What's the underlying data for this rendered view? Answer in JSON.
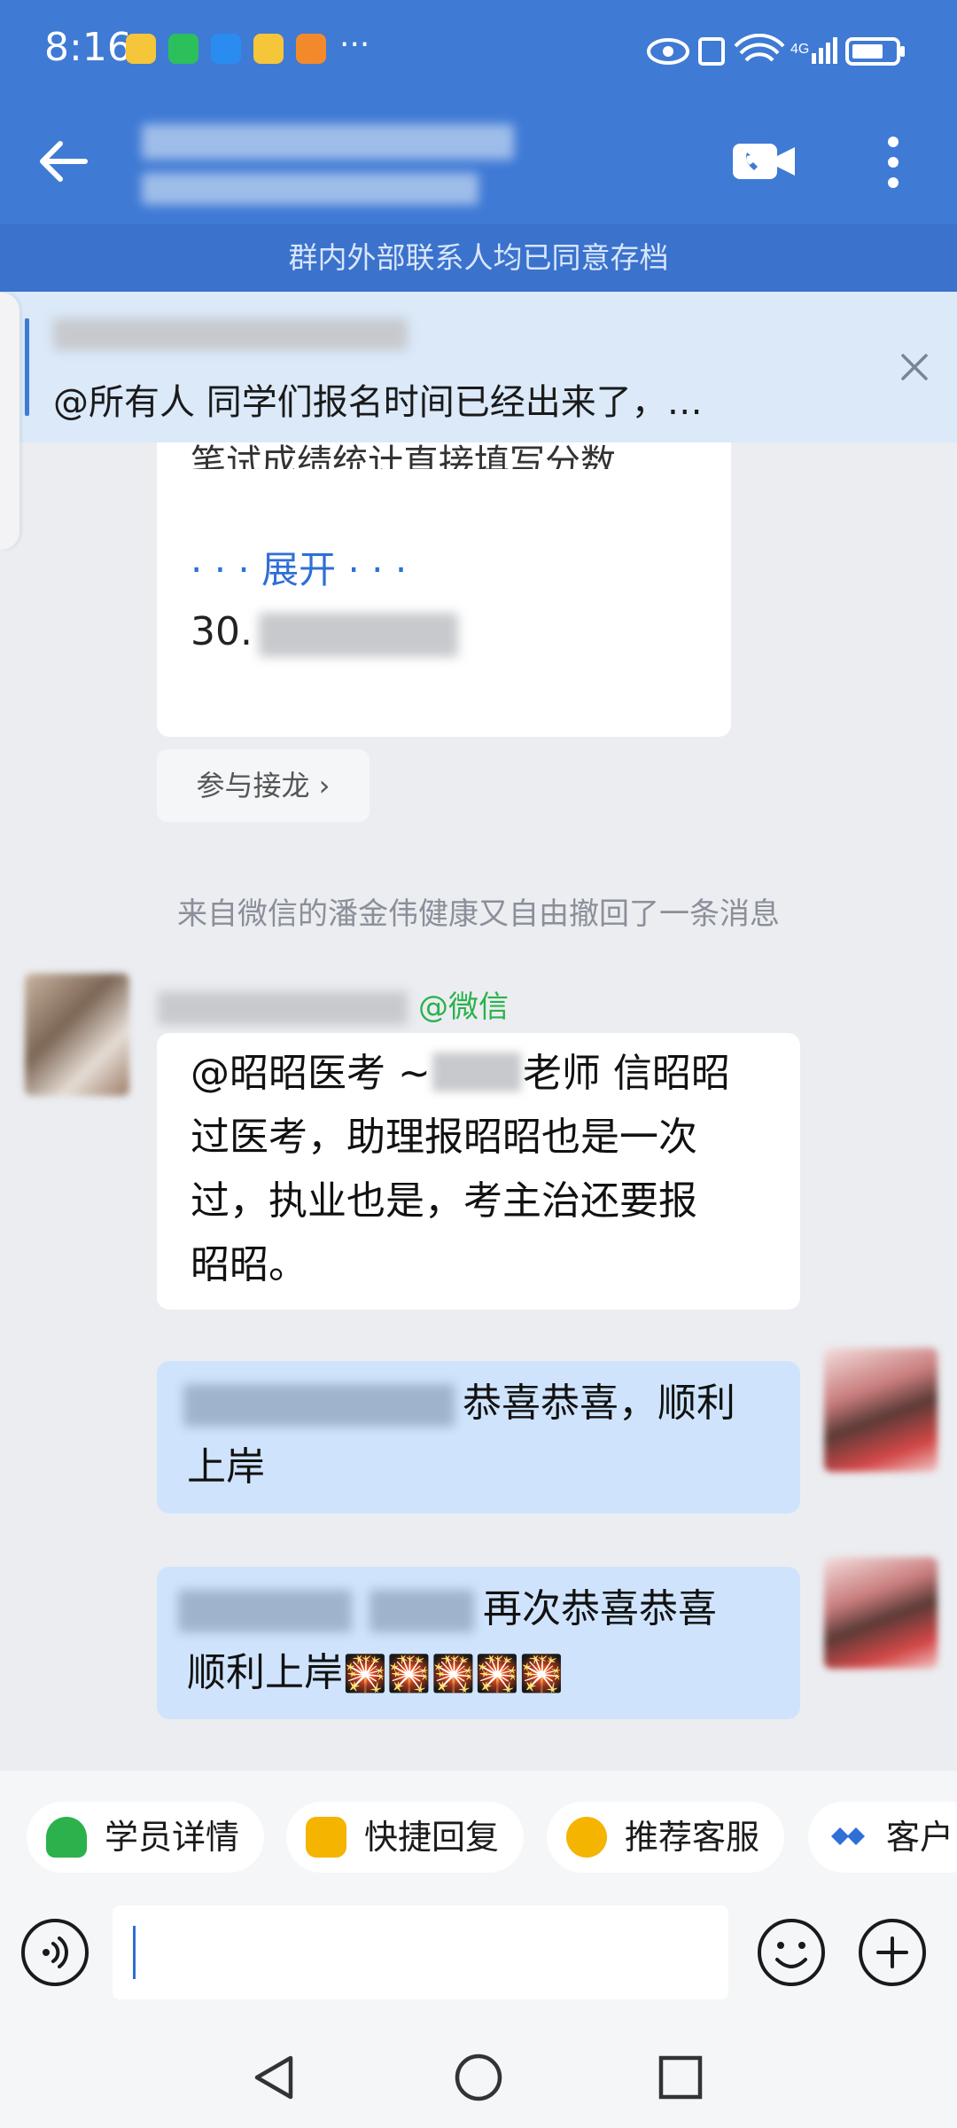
{
  "status_bar": {
    "time": "8:16",
    "overflow": "···"
  },
  "header": {
    "back_icon": "arrow-left-icon",
    "video_icon": "video-call-icon",
    "more_icon": "more-vertical-icon"
  },
  "archive_banner": "群内外部联系人均已同意存档",
  "pinned_notice": {
    "text": "@所有人  同学们报名时间已经出来了，…",
    "close_icon": "close-icon"
  },
  "solitaire_card": {
    "cut_line": "笔试成绩统计直接填写分数",
    "expand": "· · · 展开 · · ·",
    "item_number": "30.",
    "join_button": "参与接龙 ›"
  },
  "system_notice": "来自微信的潘金伟健康又自由撤回了一条消息",
  "messages": [
    {
      "sender_tag": "@微信",
      "text_line1": "@昭昭医考 ~",
      "text_line1_tail": "老师 信昭昭",
      "text_rest": [
        "过医考，助理报昭昭也是一次",
        "过，执业也是，考主治还要报",
        "昭昭。"
      ]
    },
    {
      "line1_tail": "恭喜恭喜，顺利",
      "line2": "上岸"
    },
    {
      "line1_tail": "再次恭喜恭喜",
      "line2": "顺利上岸",
      "emoji": "🎇🎇🎇🎇🎇"
    }
  ],
  "quick_actions": [
    "学员详情",
    "快捷回复",
    "推荐客服",
    "客户"
  ],
  "input": {
    "placeholder": ""
  },
  "colors": {
    "primary": "#3f7ad5",
    "bubble_me": "#cfe4fc",
    "wechat_green": "#2bb24c",
    "link_blue": "#2f6fd6"
  }
}
